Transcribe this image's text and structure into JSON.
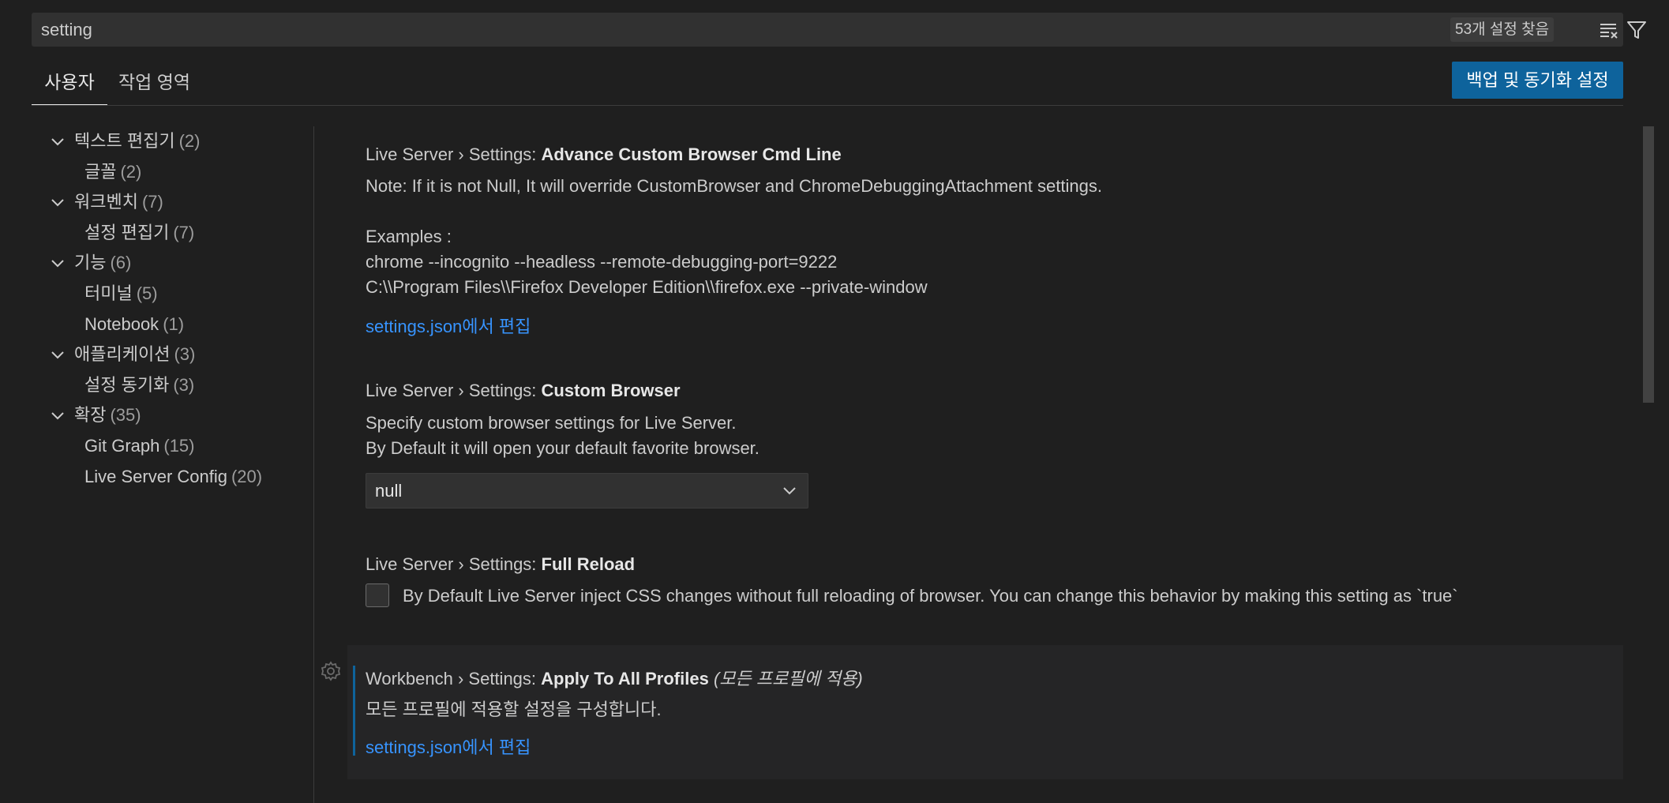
{
  "search": {
    "value": "setting",
    "result_count": "53개 설정 찾음"
  },
  "tabs": [
    {
      "label": "사용자",
      "active": true
    },
    {
      "label": "작업 영역",
      "active": false
    }
  ],
  "sync_button": "백업 및 동기화 설정",
  "toc": [
    {
      "label": "텍스트 편집기",
      "count": "(2)",
      "expanded": true,
      "level": 0
    },
    {
      "label": "글꼴",
      "count": "(2)",
      "level": 1
    },
    {
      "label": "워크벤치",
      "count": "(7)",
      "expanded": true,
      "level": 0
    },
    {
      "label": "설정 편집기",
      "count": "(7)",
      "level": 1
    },
    {
      "label": "기능",
      "count": "(6)",
      "expanded": true,
      "level": 0
    },
    {
      "label": "터미널",
      "count": "(5)",
      "level": 1
    },
    {
      "label": "Notebook",
      "count": "(1)",
      "level": 1
    },
    {
      "label": "애플리케이션",
      "count": "(3)",
      "expanded": true,
      "level": 0
    },
    {
      "label": "설정 동기화",
      "count": "(3)",
      "level": 1
    },
    {
      "label": "확장",
      "count": "(35)",
      "expanded": true,
      "level": 0
    },
    {
      "label": "Git Graph",
      "count": "(15)",
      "level": 1
    },
    {
      "label": "Live Server Config",
      "count": "(20)",
      "level": 1
    }
  ],
  "settings": {
    "advance": {
      "prefix": "Live Server › Settings: ",
      "name": "Advance Custom Browser Cmd Line",
      "desc1": "Note: If it is not Null, It will override CustomBrowser and ChromeDebuggingAttachment settings.",
      "desc2": "Examples :",
      "desc3": "chrome --incognito --headless --remote-debugging-port=9222",
      "desc4": "C:\\\\Program Files\\\\Firefox Developer Edition\\\\firefox.exe --private-window",
      "link": "settings.json에서 편집"
    },
    "custom_browser": {
      "prefix": "Live Server › Settings: ",
      "name": "Custom Browser",
      "desc1": "Specify custom browser settings for Live Server.",
      "desc2": "By Default it will open your default favorite browser.",
      "select_value": "null"
    },
    "full_reload": {
      "prefix": "Live Server › Settings: ",
      "name": "Full Reload",
      "checkbox_label": "By Default Live Server inject CSS changes without full reloading of browser. You can change this behavior by making this setting as `true`",
      "checked": false
    },
    "apply_all": {
      "prefix": "Workbench › Settings: ",
      "name": "Apply To All Profiles",
      "note": "(모든 프로필에 적용)",
      "desc": "모든 프로필에 적용할 설정을 구성합니다.",
      "link": "settings.json에서 편집"
    }
  },
  "colors": {
    "background": "#1f1f1f",
    "accent": "#0e639c",
    "link": "#3794ff"
  }
}
